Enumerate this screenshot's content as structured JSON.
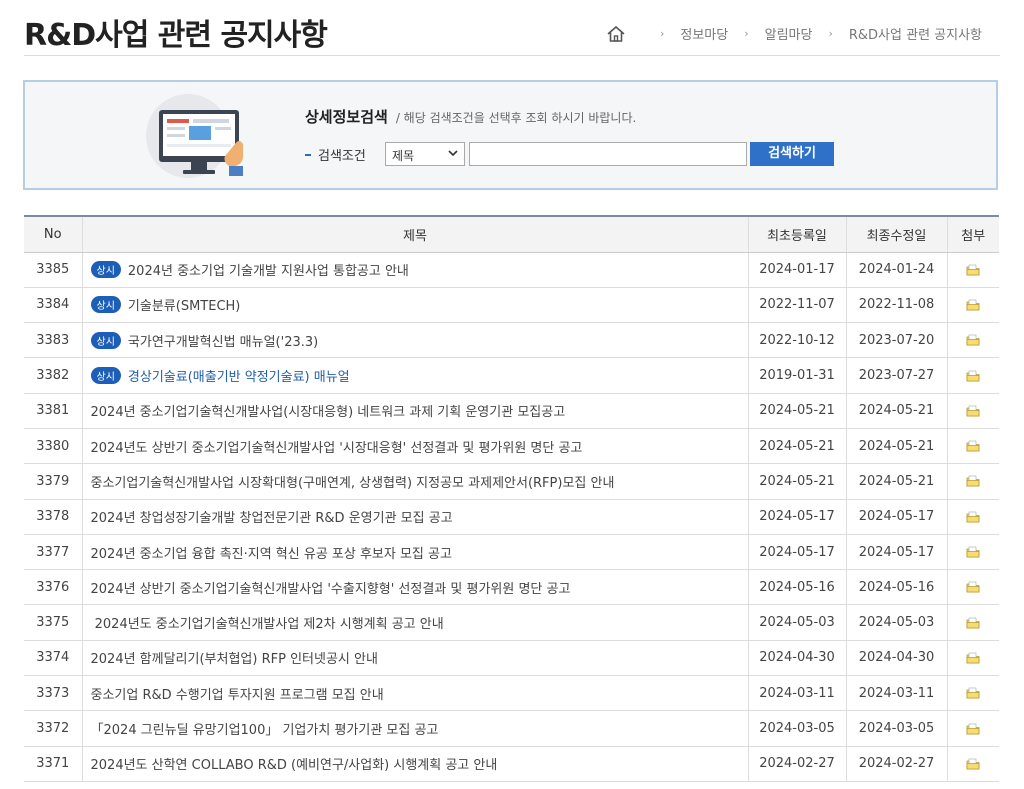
{
  "header": {
    "title": "R&D사업 관련 공지사항",
    "breadcrumb": [
      "정보마당",
      "알림마당",
      "R&D사업 관련 공지사항"
    ]
  },
  "search": {
    "heading": "상세정보검색",
    "subtext": "/ 해당 검색조건을 선택후 조회 하시기 바랍니다.",
    "condition_label": "검색조건",
    "select_value": "제목",
    "keyword_value": "",
    "button_label": "검색하기"
  },
  "table": {
    "columns": [
      "No",
      "제목",
      "최초등록일",
      "최종수정일",
      "첨부"
    ],
    "badge_label": "상시",
    "rows": [
      {
        "no": "3385",
        "badge": true,
        "title": "2024년 중소기업 기술개발 지원사업 통합공고 안내",
        "created": "2024-01-17",
        "modified": "2024-01-24",
        "attach": true
      },
      {
        "no": "3384",
        "badge": true,
        "title": "기술분류(SMTECH)",
        "created": "2022-11-07",
        "modified": "2022-11-08",
        "attach": true
      },
      {
        "no": "3383",
        "badge": true,
        "title": "국가연구개발혁신법 매뉴얼('23.3)",
        "created": "2022-10-12",
        "modified": "2023-07-20",
        "attach": true
      },
      {
        "no": "3382",
        "badge": true,
        "title": "경상기술료(매출기반 약정기술료) 매뉴얼",
        "created": "2019-01-31",
        "modified": "2023-07-27",
        "attach": true,
        "highlight": true
      },
      {
        "no": "3381",
        "badge": false,
        "title": "2024년 중소기업기술혁신개발사업(시장대응형) 네트워크 과제 기획 운영기관 모집공고",
        "created": "2024-05-21",
        "modified": "2024-05-21",
        "attach": true
      },
      {
        "no": "3380",
        "badge": false,
        "title": "2024년도 상반기 중소기업기술혁신개발사업 '시장대응형' 선정결과 및 평가위원 명단 공고",
        "created": "2024-05-21",
        "modified": "2024-05-21",
        "attach": true
      },
      {
        "no": "3379",
        "badge": false,
        "title": "중소기업기술혁신개발사업 시장확대형(구매연계, 상생협력) 지정공모 과제제안서(RFP)모집 안내",
        "created": "2024-05-21",
        "modified": "2024-05-21",
        "attach": true
      },
      {
        "no": "3378",
        "badge": false,
        "title": "2024년 창업성장기술개발 창업전문기관 R&D 운영기관 모집 공고",
        "created": "2024-05-17",
        "modified": "2024-05-17",
        "attach": true
      },
      {
        "no": "3377",
        "badge": false,
        "title": "2024년 중소기업 융합 촉진·지역 혁신 유공 포상 후보자 모집 공고",
        "created": "2024-05-17",
        "modified": "2024-05-17",
        "attach": true
      },
      {
        "no": "3376",
        "badge": false,
        "title": "2024년 상반기 중소기업기술혁신개발사업 '수출지향형' 선정결과 및 평가위원 명단 공고",
        "created": "2024-05-16",
        "modified": "2024-05-16",
        "attach": true
      },
      {
        "no": "3375",
        "badge": false,
        "title": " 2024년도 중소기업기술혁신개발사업 제2차 시행계획 공고 안내",
        "created": "2024-05-03",
        "modified": "2024-05-03",
        "attach": true
      },
      {
        "no": "3374",
        "badge": false,
        "title": "2024년 함께달리기(부처협업) RFP 인터넷공시 안내",
        "created": "2024-04-30",
        "modified": "2024-04-30",
        "attach": true
      },
      {
        "no": "3373",
        "badge": false,
        "title": "중소기업 R&D 수행기업 투자지원 프로그램 모집 안내",
        "created": "2024-03-11",
        "modified": "2024-03-11",
        "attach": true
      },
      {
        "no": "3372",
        "badge": false,
        "title": "「2024 그린뉴딜 유망기업100」 기업가치 평가기관 모집 공고",
        "created": "2024-03-05",
        "modified": "2024-03-05",
        "attach": true
      },
      {
        "no": "3371",
        "badge": false,
        "title": "2024년도 산학연 COLLABO R&D (예비연구/사업화) 시행계획 공고 안내",
        "created": "2024-02-27",
        "modified": "2024-02-27",
        "attach": true
      }
    ]
  },
  "colors": {
    "badge_bg": "#1d5fb8",
    "button_bg": "#2f70c9",
    "search_border": "#b6cde6",
    "link_blue": "#1f5fae"
  },
  "icons": {
    "home": "home-icon",
    "attachment": "folder-attachment-icon",
    "dropdown": "chevron-down-icon"
  }
}
